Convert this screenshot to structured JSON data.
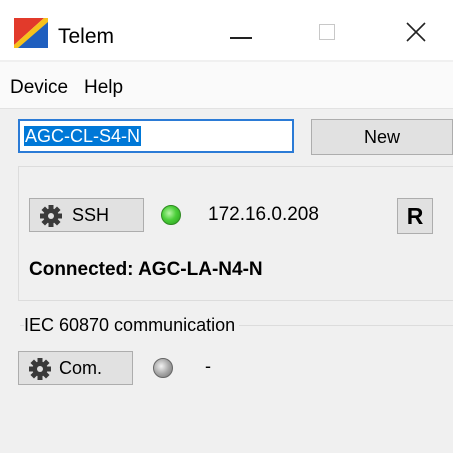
{
  "window": {
    "title": "Telem",
    "icon": "telem-app-icon",
    "controls": [
      "minimize-icon",
      "maximize-icon",
      "close-icon"
    ]
  },
  "menu": {
    "items": [
      {
        "label": "Device"
      },
      {
        "label": "Help"
      }
    ]
  },
  "device_selector": {
    "value": "AGC-CL-S4-N",
    "new_label": "New"
  },
  "connection": {
    "ssh_label": "SSH",
    "ssh_icon": "gear-icon",
    "status_color": "#4ccf3a",
    "ip_address": "172.16.0.208",
    "r_label": "R",
    "connected_text": "Connected: AGC-LA-N4-N"
  },
  "iec": {
    "section_label": "IEC 60870 communication",
    "com_label": "Com.",
    "com_icon": "gear-icon",
    "status_color": "#a9a9a9",
    "status_text": "-"
  }
}
